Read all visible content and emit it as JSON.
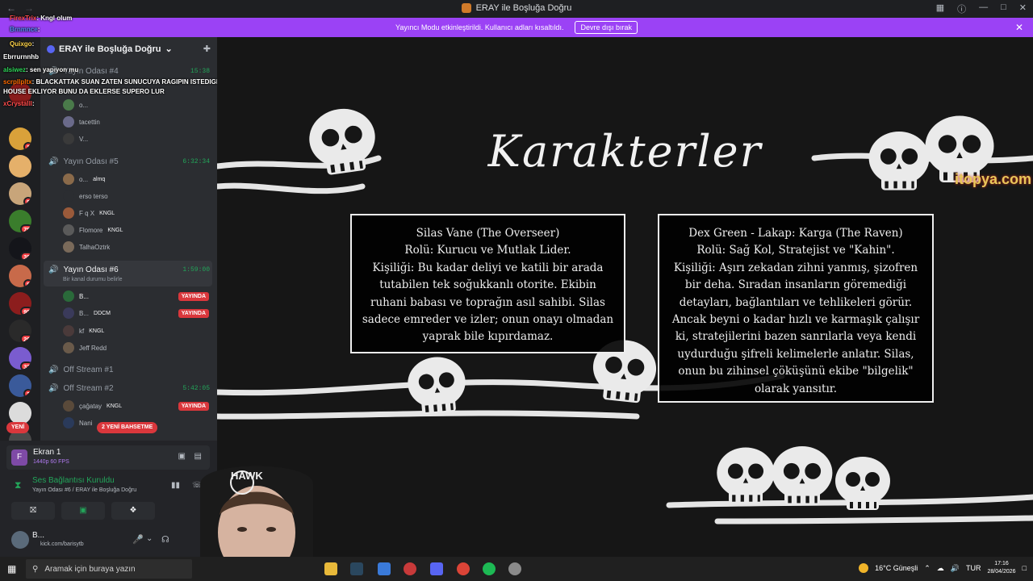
{
  "window": {
    "title": "ERAY ile Boşluğa Doğru",
    "back_icon": "arrow-left-icon",
    "forward_icon": "arrow-right-icon"
  },
  "banner": {
    "message": "Yayıncı Modu etkinleştirildi. Kullanıcı adları kısaltıldı.",
    "button": "Devre dışı bırak"
  },
  "chat_overlay": [
    {
      "user": "FirexTrix",
      "text": ": Kngl olum",
      "color": "#ff4d4d"
    },
    {
      "user": "Brnmnce",
      "text": ":",
      "color": "#5b8cff"
    },
    {
      "user": "Quixgo",
      "text": ":",
      "color": "#ffd54a"
    },
    {
      "user": "Ebrrurnnhb",
      "text": "",
      "color": "#ffffff"
    },
    {
      "user": "alsiwez",
      "text": ": sen yapıyon mu",
      "color": "#2fd65a"
    },
    {
      "user": "scrpllpltx",
      "text": ": BLACKATTAK SUAN ZATEN SUNUCUYA RAGIPIN ISTEDIGI HOMELESS",
      "color": "#ff6b00"
    },
    {
      "user": "",
      "text": "HOUSE EKLIYOR BUNU DA EKLERSE SUPERO LUR",
      "color": "#ffffff"
    },
    {
      "user": "xCrystalll",
      "text": ":",
      "color": "#ff4d4d"
    }
  ],
  "servers": [
    {
      "badge": ""
    },
    {
      "badge": "1"
    },
    {
      "badge": ""
    },
    {
      "badge": "8"
    },
    {
      "badge": "75"
    },
    {
      "badge": "38"
    },
    {
      "badge": "8"
    },
    {
      "badge": "98"
    },
    {
      "badge": "26"
    },
    {
      "badge": "32"
    },
    {
      "badge": "2"
    },
    {
      "badge": ""
    },
    {
      "badge": ""
    }
  ],
  "sidebar": {
    "guild_name": "ERAY ile Boşluğa Doğru",
    "new_label": "YENİ",
    "new_mentions": "2 YENİ BAHSETME",
    "channels": [
      {
        "name": "Yayın Odası #4",
        "time": "15:38"
      },
      {
        "name": "Yayın Odası #5",
        "time": "6:32:34"
      },
      {
        "name": "Yayın Odası #6",
        "time": "1:59:00",
        "status": "Bir kanal durumu belirle"
      },
      {
        "name": "Off Stream #1",
        "time": ""
      },
      {
        "name": "Off Stream #2",
        "time": "5:42:05"
      }
    ],
    "users4": [
      "o...",
      "tacettin",
      "V..."
    ],
    "users5": [
      {
        "name": "o...",
        "tag": "almq"
      },
      {
        "name": "erso terso",
        "tag": ""
      },
      {
        "name": "F q X",
        "tag": "KNGL"
      },
      {
        "name": "Flomore",
        "tag": "KNGL"
      },
      {
        "name": "TalhaOztrk",
        "tag": ""
      }
    ],
    "users6": [
      {
        "name": "B...",
        "tag": "",
        "live": "YAYINDA"
      },
      {
        "name": "B...",
        "tag": "DDCM",
        "live": "YAYINDA"
      },
      {
        "name": "kf",
        "tag": "KNGL",
        "live": ""
      },
      {
        "name": "Jeff Redd",
        "tag": "",
        "live": ""
      }
    ],
    "users_off2": [
      {
        "name": "çağatay",
        "tag": "KNGL",
        "live": "YAYINDA"
      },
      {
        "name": "Nani",
        "tag": "",
        "live": ""
      }
    ]
  },
  "user_panel": {
    "screen_title": "Ekran 1",
    "screen_quality": "1440p 60 FPS",
    "voice_status": "Ses Bağlantısı Kuruldu",
    "voice_channel": "Yayın Odası #6 / ERAY ile Boşluğa Doğru",
    "username": "B...",
    "custom_status": "kick.com/barisytb"
  },
  "stage": {
    "heading": "Karakterler",
    "watermark": "itopya.com",
    "card_left": [
      "Silas Vane (The Overseer)",
      "Rolü: Kurucu ve Mutlak Lider.",
      "Kişiliği: Bu kadar deliyi ve katili bir arada",
      "tutabilen tek soğukkanlı otorite. Ekibin",
      "ruhani babası ve toprağın asıl sahibi. Silas",
      "sadece emreder ve izler; onun onayı olmadan",
      "yaprak bile kıpırdamaz."
    ],
    "card_right": [
      "Dex Green - Lakap: Karga (The Raven)",
      "Rolü: Sağ Kol, Stratejist ve \"Kahin\".",
      "Kişiliği: Aşırı zekadan zihni yanmış, şizofren",
      "bir deha. Sıradan insanların göremediği",
      "detayları, bağlantıları ve tehlikeleri görür.",
      "Ancak beyni o kadar hızlı ve karmaşık çalışır",
      "ki, stratejilerini bazen sanrılarla veya kendi",
      "uydurduğu şifreli kelimelerle anlatır. Silas,",
      "onun bu zihinsel çöküşünü ekibe \"bilgelik\"",
      "olarak yansıtır."
    ],
    "cam_logo": "HAWK"
  },
  "taskbar": {
    "search_placeholder": "Aramak için buraya yazın",
    "weather": "16°C Güneşli",
    "lang": "TUR",
    "time": "17:16",
    "date": "28/04/2026"
  }
}
